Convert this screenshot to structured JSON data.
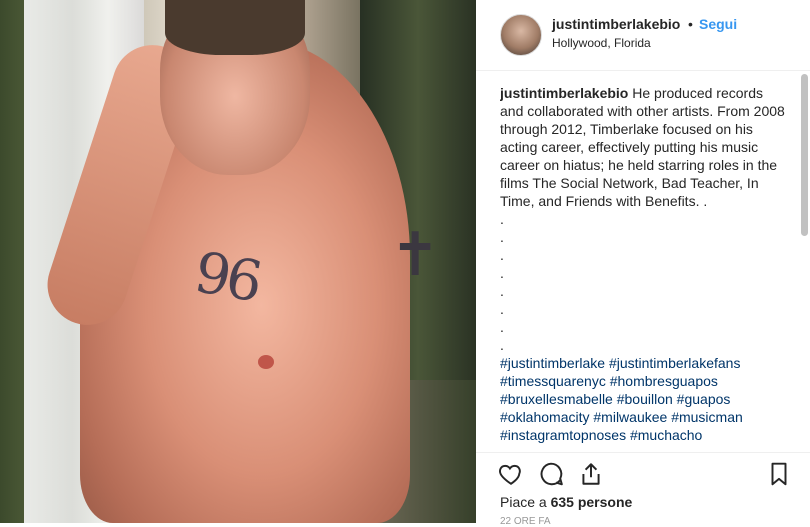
{
  "post": {
    "username": "justintimberlakebio",
    "separator": "•",
    "follow_label": "Segui",
    "location": "Hollywood, Florida"
  },
  "caption": {
    "author": "justintimberlakebio",
    "text": "He produced records and collaborated with other artists. From 2008 through 2012, Timberlake focused on his acting career, effectively putting his music career on hiatus; he held starring roles in the films The Social Network, Bad Teacher, In Time, and Friends with Benefits. .",
    "dots": ".\n.\n.\n.\n.\n.\n.\n.",
    "hashtags": "#justintimberlake #justintimberlakefans #timessquarenyc #hombresguapos #bruxellesmabelle #bouillon #guapos #oklahomacity #milwaukee #musicman #instagramtopnoses #muchacho"
  },
  "actions": {
    "like_icon": "heart-icon",
    "comment_icon": "comment-icon",
    "share_icon": "share-icon",
    "save_icon": "bookmark-icon"
  },
  "likes": {
    "prefix": "Piace a",
    "count": "635 persone"
  },
  "timestamp_partial": "22 ORE FA",
  "photo": {
    "tattoo_number": "96",
    "cross_glyph": "✝"
  }
}
